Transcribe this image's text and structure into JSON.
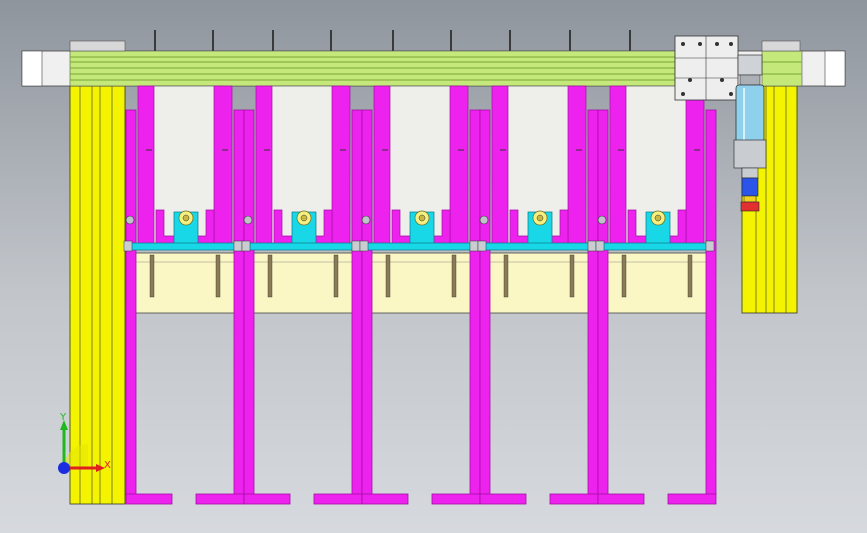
{
  "axes": {
    "x": "X",
    "y": "Y"
  },
  "colors": {
    "frame_yellow": "#f4f400",
    "frame_yellow_dark": "#b8b800",
    "rail_green": "#c4e87a",
    "rail_green_dark": "#7aa335",
    "magenta": "#ee22ee",
    "magenta_dark": "#a010a0",
    "cyan": "#18d8e8",
    "cream": "#fbf7c4",
    "panel_white": "#eeeeea",
    "steel": "#c9cdd2",
    "cylinder_blue": "#8fd0ec"
  },
  "station_count": 5,
  "guide_rod_count": 10,
  "components": {
    "top_rail": "linear-guide-rail",
    "left_column": "support-column-left",
    "right_column": "support-column-right",
    "cylinder": "pneumatic-cylinder",
    "gripper": "suction-gripper"
  }
}
